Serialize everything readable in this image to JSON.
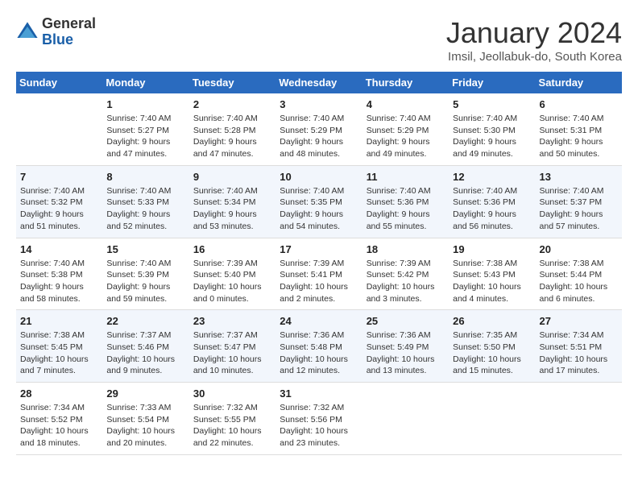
{
  "header": {
    "logo": {
      "general": "General",
      "blue": "Blue"
    },
    "title": "January 2024",
    "subtitle": "Imsil, Jeollabuk-do, South Korea"
  },
  "days_of_week": [
    "Sunday",
    "Monday",
    "Tuesday",
    "Wednesday",
    "Thursday",
    "Friday",
    "Saturday"
  ],
  "weeks": [
    [
      {
        "day": "",
        "sunrise": "",
        "sunset": "",
        "daylight": ""
      },
      {
        "day": "1",
        "sunrise": "Sunrise: 7:40 AM",
        "sunset": "Sunset: 5:27 PM",
        "daylight": "Daylight: 9 hours and 47 minutes."
      },
      {
        "day": "2",
        "sunrise": "Sunrise: 7:40 AM",
        "sunset": "Sunset: 5:28 PM",
        "daylight": "Daylight: 9 hours and 47 minutes."
      },
      {
        "day": "3",
        "sunrise": "Sunrise: 7:40 AM",
        "sunset": "Sunset: 5:29 PM",
        "daylight": "Daylight: 9 hours and 48 minutes."
      },
      {
        "day": "4",
        "sunrise": "Sunrise: 7:40 AM",
        "sunset": "Sunset: 5:29 PM",
        "daylight": "Daylight: 9 hours and 49 minutes."
      },
      {
        "day": "5",
        "sunrise": "Sunrise: 7:40 AM",
        "sunset": "Sunset: 5:30 PM",
        "daylight": "Daylight: 9 hours and 49 minutes."
      },
      {
        "day": "6",
        "sunrise": "Sunrise: 7:40 AM",
        "sunset": "Sunset: 5:31 PM",
        "daylight": "Daylight: 9 hours and 50 minutes."
      }
    ],
    [
      {
        "day": "7",
        "sunrise": "Sunrise: 7:40 AM",
        "sunset": "Sunset: 5:32 PM",
        "daylight": "Daylight: 9 hours and 51 minutes."
      },
      {
        "day": "8",
        "sunrise": "Sunrise: 7:40 AM",
        "sunset": "Sunset: 5:33 PM",
        "daylight": "Daylight: 9 hours and 52 minutes."
      },
      {
        "day": "9",
        "sunrise": "Sunrise: 7:40 AM",
        "sunset": "Sunset: 5:34 PM",
        "daylight": "Daylight: 9 hours and 53 minutes."
      },
      {
        "day": "10",
        "sunrise": "Sunrise: 7:40 AM",
        "sunset": "Sunset: 5:35 PM",
        "daylight": "Daylight: 9 hours and 54 minutes."
      },
      {
        "day": "11",
        "sunrise": "Sunrise: 7:40 AM",
        "sunset": "Sunset: 5:36 PM",
        "daylight": "Daylight: 9 hours and 55 minutes."
      },
      {
        "day": "12",
        "sunrise": "Sunrise: 7:40 AM",
        "sunset": "Sunset: 5:36 PM",
        "daylight": "Daylight: 9 hours and 56 minutes."
      },
      {
        "day": "13",
        "sunrise": "Sunrise: 7:40 AM",
        "sunset": "Sunset: 5:37 PM",
        "daylight": "Daylight: 9 hours and 57 minutes."
      }
    ],
    [
      {
        "day": "14",
        "sunrise": "Sunrise: 7:40 AM",
        "sunset": "Sunset: 5:38 PM",
        "daylight": "Daylight: 9 hours and 58 minutes."
      },
      {
        "day": "15",
        "sunrise": "Sunrise: 7:40 AM",
        "sunset": "Sunset: 5:39 PM",
        "daylight": "Daylight: 9 hours and 59 minutes."
      },
      {
        "day": "16",
        "sunrise": "Sunrise: 7:39 AM",
        "sunset": "Sunset: 5:40 PM",
        "daylight": "Daylight: 10 hours and 0 minutes."
      },
      {
        "day": "17",
        "sunrise": "Sunrise: 7:39 AM",
        "sunset": "Sunset: 5:41 PM",
        "daylight": "Daylight: 10 hours and 2 minutes."
      },
      {
        "day": "18",
        "sunrise": "Sunrise: 7:39 AM",
        "sunset": "Sunset: 5:42 PM",
        "daylight": "Daylight: 10 hours and 3 minutes."
      },
      {
        "day": "19",
        "sunrise": "Sunrise: 7:38 AM",
        "sunset": "Sunset: 5:43 PM",
        "daylight": "Daylight: 10 hours and 4 minutes."
      },
      {
        "day": "20",
        "sunrise": "Sunrise: 7:38 AM",
        "sunset": "Sunset: 5:44 PM",
        "daylight": "Daylight: 10 hours and 6 minutes."
      }
    ],
    [
      {
        "day": "21",
        "sunrise": "Sunrise: 7:38 AM",
        "sunset": "Sunset: 5:45 PM",
        "daylight": "Daylight: 10 hours and 7 minutes."
      },
      {
        "day": "22",
        "sunrise": "Sunrise: 7:37 AM",
        "sunset": "Sunset: 5:46 PM",
        "daylight": "Daylight: 10 hours and 9 minutes."
      },
      {
        "day": "23",
        "sunrise": "Sunrise: 7:37 AM",
        "sunset": "Sunset: 5:47 PM",
        "daylight": "Daylight: 10 hours and 10 minutes."
      },
      {
        "day": "24",
        "sunrise": "Sunrise: 7:36 AM",
        "sunset": "Sunset: 5:48 PM",
        "daylight": "Daylight: 10 hours and 12 minutes."
      },
      {
        "day": "25",
        "sunrise": "Sunrise: 7:36 AM",
        "sunset": "Sunset: 5:49 PM",
        "daylight": "Daylight: 10 hours and 13 minutes."
      },
      {
        "day": "26",
        "sunrise": "Sunrise: 7:35 AM",
        "sunset": "Sunset: 5:50 PM",
        "daylight": "Daylight: 10 hours and 15 minutes."
      },
      {
        "day": "27",
        "sunrise": "Sunrise: 7:34 AM",
        "sunset": "Sunset: 5:51 PM",
        "daylight": "Daylight: 10 hours and 17 minutes."
      }
    ],
    [
      {
        "day": "28",
        "sunrise": "Sunrise: 7:34 AM",
        "sunset": "Sunset: 5:52 PM",
        "daylight": "Daylight: 10 hours and 18 minutes."
      },
      {
        "day": "29",
        "sunrise": "Sunrise: 7:33 AM",
        "sunset": "Sunset: 5:54 PM",
        "daylight": "Daylight: 10 hours and 20 minutes."
      },
      {
        "day": "30",
        "sunrise": "Sunrise: 7:32 AM",
        "sunset": "Sunset: 5:55 PM",
        "daylight": "Daylight: 10 hours and 22 minutes."
      },
      {
        "day": "31",
        "sunrise": "Sunrise: 7:32 AM",
        "sunset": "Sunset: 5:56 PM",
        "daylight": "Daylight: 10 hours and 23 minutes."
      },
      {
        "day": "",
        "sunrise": "",
        "sunset": "",
        "daylight": ""
      },
      {
        "day": "",
        "sunrise": "",
        "sunset": "",
        "daylight": ""
      },
      {
        "day": "",
        "sunrise": "",
        "sunset": "",
        "daylight": ""
      }
    ]
  ]
}
